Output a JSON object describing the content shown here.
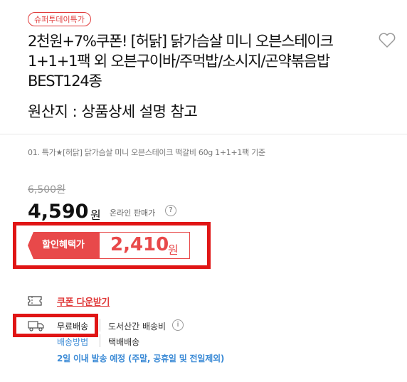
{
  "badge": "슈퍼투데이특가",
  "product": {
    "title": "2천원+7%쿠폰! [허닭] 닭가슴살 미니 오븐스테이크 1+1+1팩 외 오븐구이바/주먹밥/소시지/곤약볶음밥 BEST124종",
    "origin": "원산지 : 상품상세 설명 참고"
  },
  "option": "01. 특가★[허닭] 닭가슴살 미니 오븐스테이크 떡갈비 60g 1+1+1팩 기준",
  "price": {
    "original": "6,500원",
    "sale": "4,590",
    "sale_unit": "원",
    "sale_note": "온라인 판매가",
    "help": "?"
  },
  "discount": {
    "label": "할인혜택가",
    "value": "2,410",
    "unit": "원"
  },
  "coupon": {
    "label": "쿠폰 다운받기"
  },
  "shipping": {
    "free": "무료배송",
    "remote": "도서산간 배송비",
    "info": "i",
    "method": "배송방법",
    "courier": "택배배송",
    "eta": "2일 이내 발송 예정 (주말, 공휴일 및 전일제외)"
  },
  "colors": {
    "accent": "#e8494a",
    "highlight_box": "#e01515",
    "link_blue": "#3c8bd6"
  },
  "icons": [
    "heart-icon",
    "coupon-icon",
    "truck-icon",
    "help-icon",
    "info-icon"
  ]
}
